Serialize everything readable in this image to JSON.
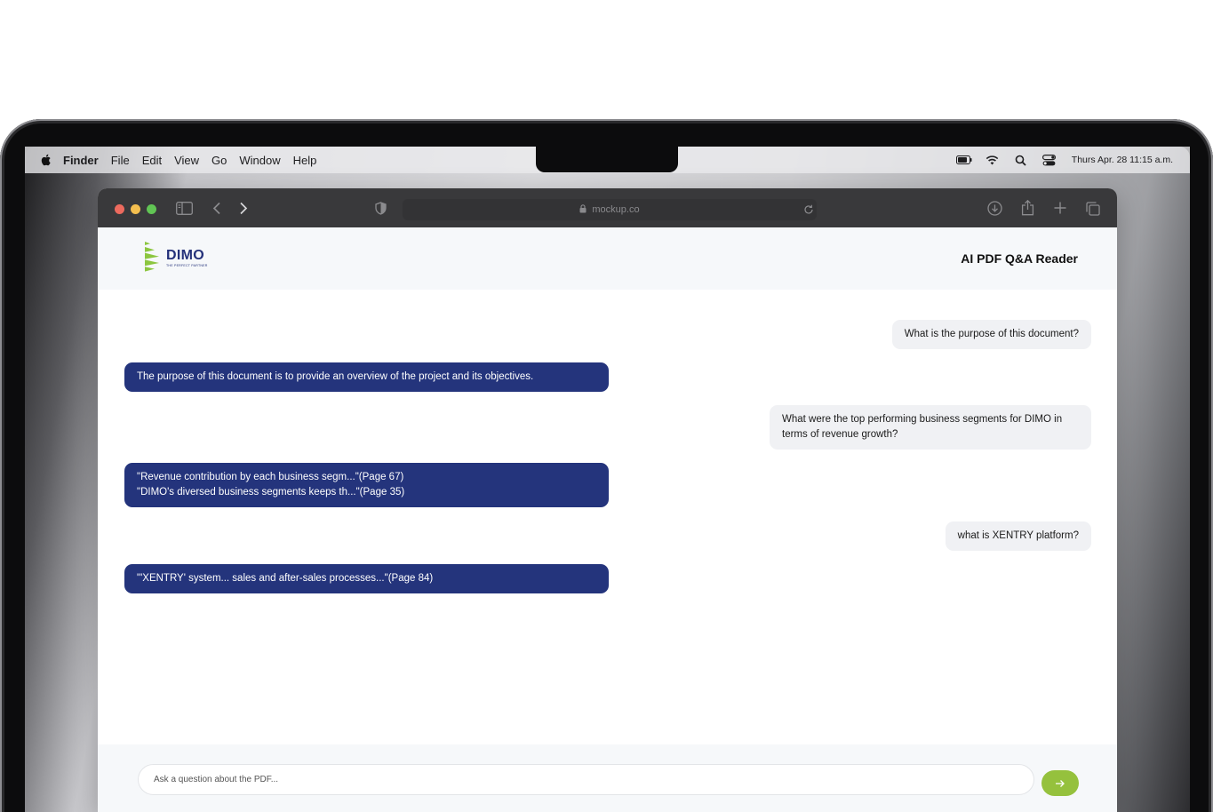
{
  "menubar": {
    "apple_icon": "apple-logo-icon",
    "items": [
      "Finder",
      "File",
      "Edit",
      "View",
      "Go",
      "Window",
      "Help"
    ],
    "status_icons": [
      "battery-icon",
      "wifi-icon",
      "search-icon",
      "control-center-icon"
    ],
    "clock": "Thurs Apr. 28 11:15 a.m."
  },
  "browser": {
    "url": "mockup.co",
    "traffic_colors": [
      "#ec6a5e",
      "#f4bf4f",
      "#61c554"
    ]
  },
  "app": {
    "logo_name": "DIMO",
    "logo_tagline": "THE PERFECT PARTNER",
    "title": "AI PDF Q&A Reader",
    "accent": "#24347c",
    "button_color": "#95c13d"
  },
  "messages": [
    {
      "role": "user",
      "lines": [
        "What is the purpose of this document?"
      ]
    },
    {
      "role": "bot",
      "lines": [
        "The purpose of this document is to provide an overview of the project and its objectives."
      ]
    },
    {
      "role": "user",
      "lines": [
        "What were the top performing business segments for DIMO in",
        "terms of revenue growth?"
      ]
    },
    {
      "role": "bot",
      "lines": [
        "\"Revenue contribution by each business segm...\"(Page 67)",
        "\"DIMO's diversed business segments keeps th...\"(Page 35)"
      ]
    },
    {
      "role": "user",
      "lines": [
        "what is XENTRY platform?"
      ]
    },
    {
      "role": "bot",
      "lines": [
        "\"'XENTRY' system... sales and after-sales processes...\"(Page 84)"
      ]
    }
  ],
  "input": {
    "placeholder": "Ask a question about the PDF...",
    "send_icon": "arrow-right-icon"
  }
}
